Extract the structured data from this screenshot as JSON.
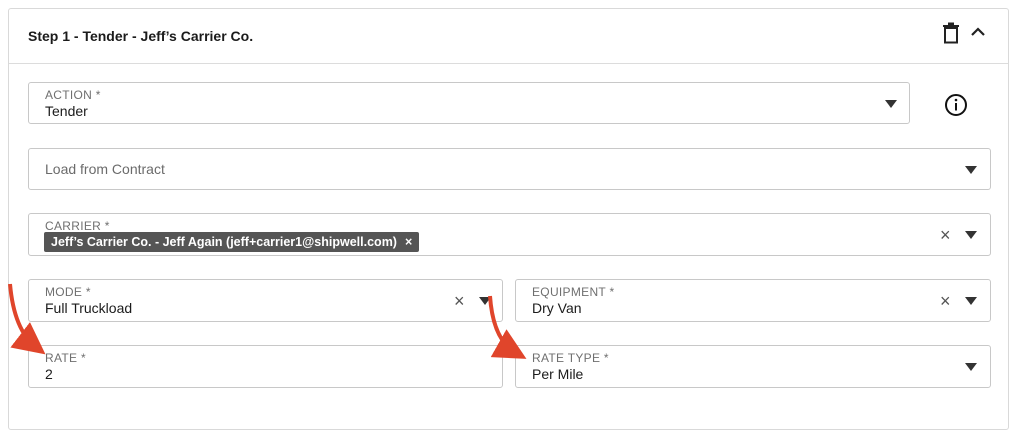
{
  "step": {
    "title": "Step 1 - Tender - Jeff’s Carrier Co."
  },
  "icons": {
    "delete": "trash-icon",
    "collapse": "chevron-up-icon",
    "info": "info-icon"
  },
  "action": {
    "label": "ACTION *",
    "value": "Tender"
  },
  "contract": {
    "placeholder": "Load from Contract"
  },
  "carrier": {
    "label": "CARRIER *",
    "tag": "Jeff’s Carrier Co. - Jeff Again (jeff+carrier1@shipwell.com)",
    "tag_remove": "×"
  },
  "mode": {
    "label": "MODE *",
    "value": "Full Truckload"
  },
  "equipment": {
    "label": "EQUIPMENT *",
    "value": "Dry Van"
  },
  "rate": {
    "label": "RATE *",
    "value": "2"
  },
  "rate_type": {
    "label": "RATE TYPE *",
    "value": "Per Mile"
  },
  "clear_symbol": "×",
  "colors": {
    "annotation_arrow": "#e0452b",
    "tag_bg": "#555555",
    "border": "#c8c8c8"
  }
}
